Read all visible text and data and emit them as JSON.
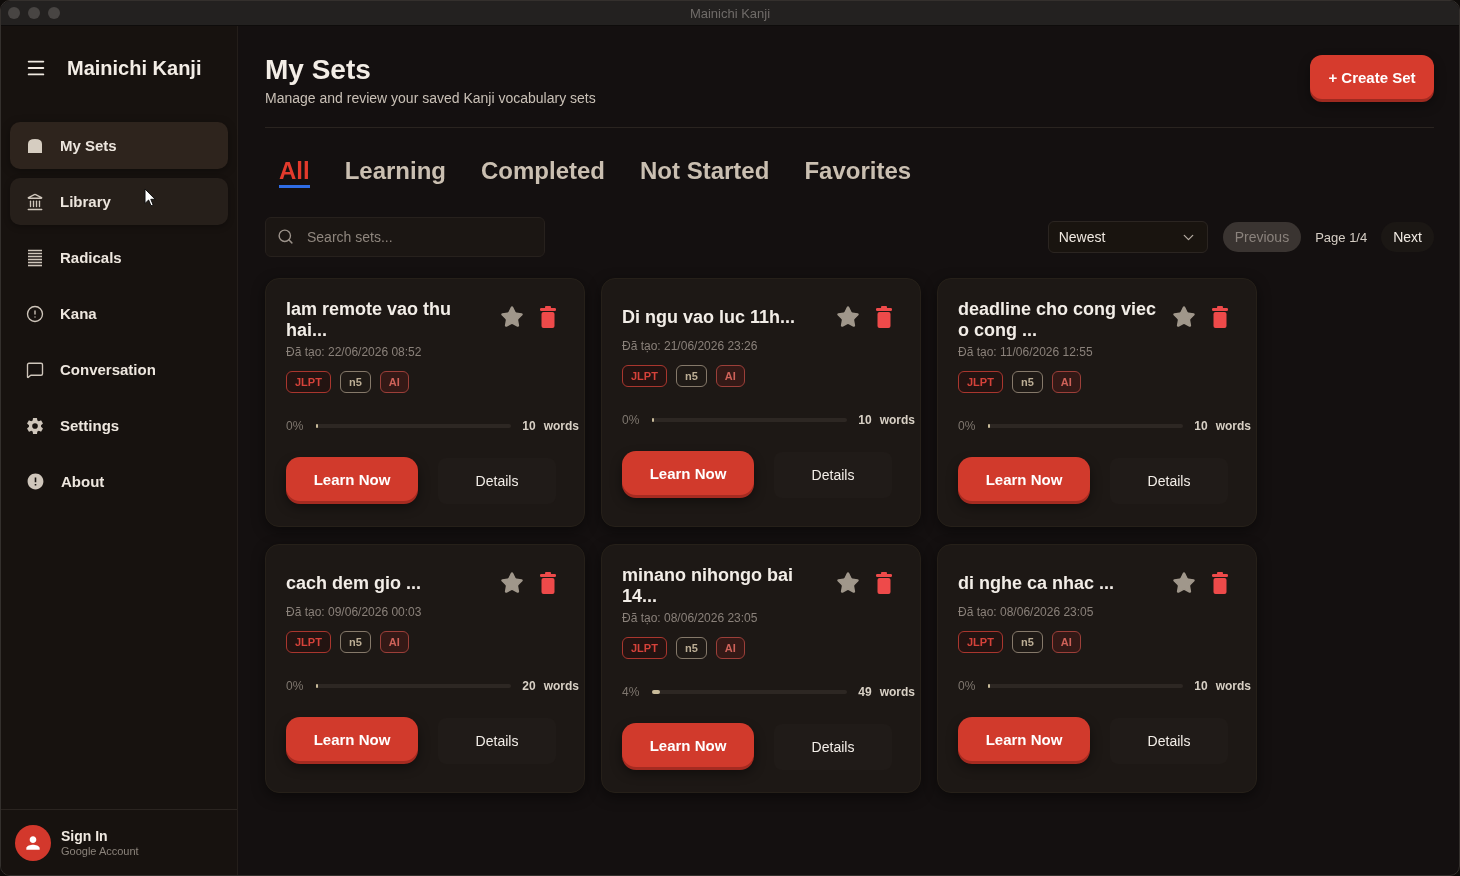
{
  "window": {
    "title": "Mainichi Kanji"
  },
  "sidebar": {
    "app_name": "Mainichi Kanji",
    "items": [
      {
        "label": "My Sets",
        "selected": true,
        "hovered": false
      },
      {
        "label": "Library",
        "selected": false,
        "hovered": true
      },
      {
        "label": "Radicals",
        "selected": false,
        "hovered": false
      },
      {
        "label": "Kana",
        "selected": false,
        "hovered": false
      },
      {
        "label": "Conversation",
        "selected": false,
        "hovered": false
      },
      {
        "label": "Settings",
        "selected": false,
        "hovered": false
      },
      {
        "label": "About",
        "selected": false,
        "hovered": false
      }
    ],
    "account": {
      "name": "Sign In",
      "detail": "Google Account"
    }
  },
  "page": {
    "title": "My Sets",
    "subtitle": "Manage and review your saved Kanji vocabulary sets",
    "create_button": "+ Create Set"
  },
  "tabs": [
    {
      "label": "All",
      "selected": true
    },
    {
      "label": "Learning",
      "selected": false
    },
    {
      "label": "Completed",
      "selected": false
    },
    {
      "label": "Not Started",
      "selected": false
    },
    {
      "label": "Favorites",
      "selected": false
    }
  ],
  "search": {
    "placeholder": "Search sets..."
  },
  "sort": {
    "value": "Newest"
  },
  "pagination": {
    "previous": {
      "label": "Previous",
      "disabled": true
    },
    "page": "Page 1/4",
    "next": {
      "label": "Next",
      "disabled": false
    }
  },
  "sets": [
    {
      "title": "lam remote vao thu hai...",
      "created": "Đã tạo: 22/06/2026 08:52",
      "favorite": false,
      "tags": [
        {
          "label": "JLPT",
          "kind": "exam"
        },
        {
          "label": "n5",
          "kind": "level"
        },
        {
          "label": "AI",
          "kind": "ai"
        }
      ],
      "progress": "0%",
      "level": 0,
      "word_count": "10",
      "word_label": "words",
      "learn_button": "Learn Now",
      "details_button": "Details"
    },
    {
      "title": "Di ngu vao luc 11h...",
      "created": "Đã tạo: 21/06/2026 23:26",
      "favorite": false,
      "tags": [
        {
          "label": "JLPT",
          "kind": "exam"
        },
        {
          "label": "n5",
          "kind": "level"
        },
        {
          "label": "AI",
          "kind": "ai"
        }
      ],
      "progress": "0%",
      "level": 0,
      "word_count": "10",
      "word_label": "words",
      "learn_button": "Learn Now",
      "details_button": "Details"
    },
    {
      "title": "deadline cho cong viec o cong ...",
      "created": "Đã tạo: 11/06/2026 12:55",
      "favorite": false,
      "tags": [
        {
          "label": "JLPT",
          "kind": "exam"
        },
        {
          "label": "n5",
          "kind": "level"
        },
        {
          "label": "AI",
          "kind": "ai"
        }
      ],
      "progress": "0%",
      "level": 0,
      "word_count": "10",
      "word_label": "words",
      "learn_button": "Learn Now",
      "details_button": "Details"
    },
    {
      "title": "cach dem gio ...",
      "created": "Đã tạo: 09/06/2026 00:03",
      "favorite": false,
      "tags": [
        {
          "label": "JLPT",
          "kind": "exam"
        },
        {
          "label": "n5",
          "kind": "level"
        },
        {
          "label": "AI",
          "kind": "ai"
        }
      ],
      "progress": "0%",
      "level": 0,
      "word_count": "20",
      "word_label": "words",
      "learn_button": "Learn Now",
      "details_button": "Details"
    },
    {
      "title": "minano nihongo bai 14...",
      "created": "Đã tạo: 08/06/2026 23:05",
      "favorite": false,
      "tags": [
        {
          "label": "JLPT",
          "kind": "exam"
        },
        {
          "label": "n5",
          "kind": "level"
        },
        {
          "label": "AI",
          "kind": "ai"
        }
      ],
      "progress": "4%",
      "level": 0.04,
      "word_count": "49",
      "word_label": "words",
      "learn_button": "Learn Now",
      "details_button": "Details"
    },
    {
      "title": "di nghe ca nhac ...",
      "created": "Đã tạo: 08/06/2026 23:05",
      "favorite": false,
      "tags": [
        {
          "label": "JLPT",
          "kind": "exam"
        },
        {
          "label": "n5",
          "kind": "level"
        },
        {
          "label": "AI",
          "kind": "ai"
        }
      ],
      "progress": "0%",
      "level": 0,
      "word_count": "10",
      "word_label": "words",
      "learn_button": "Learn Now",
      "details_button": "Details"
    }
  ]
}
